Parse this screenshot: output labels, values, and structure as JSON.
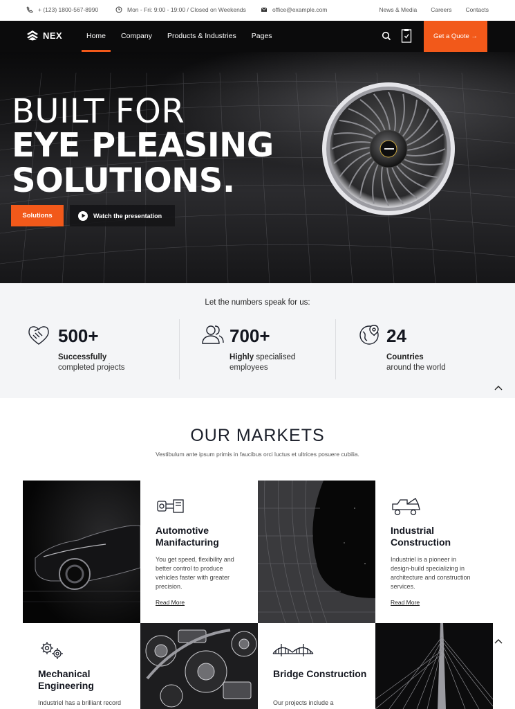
{
  "topbar": {
    "phone": "+ (123) 1800-567-8990",
    "hours": "Mon - Fri: 9:00 - 19:00 / Closed on Weekends",
    "email": "office@example.com",
    "links": [
      "News & Media",
      "Careers",
      "Contacts"
    ]
  },
  "nav": {
    "logo": "NEX",
    "items": [
      "Home",
      "Company",
      "Products & Industries",
      "Pages"
    ],
    "active": "Home",
    "quote_label": "Get a Quote →"
  },
  "hero": {
    "line1": "BUILT FOR",
    "line2": "EYE PLEASING",
    "line3": "SOLUTIONS.",
    "primary_button": "Solutions",
    "secondary_button": "Watch the presentation"
  },
  "stats": {
    "lead": "Let the numbers speak for us:",
    "items": [
      {
        "number": "500+",
        "strong": "Successfully",
        "rest": "",
        "line2": "completed projects",
        "icon": "handshake-icon"
      },
      {
        "number": "700+",
        "strong": "Highly",
        "rest": " specialised",
        "line2": "employees",
        "icon": "users-icon"
      },
      {
        "number": "24",
        "strong": "Countries",
        "rest": "",
        "line2": "around the world",
        "icon": "globe-icon"
      }
    ]
  },
  "markets": {
    "title": "OUR MARKETS",
    "subtitle": "Vestibulum ante ipsum primis in faucibus orci luctus et ultrices posuere cubilia.",
    "cards": [
      {
        "title": "Automotive Manifacturing",
        "text": "You get speed, flexibility and better control to produce vehicles faster with greater precision.",
        "more": "Read More",
        "icon": "piston-icon"
      },
      {
        "title": "Industrial Construction",
        "text": "Industriel is a pioneer in design-build specializing in architecture and construction services.",
        "more": "Read More",
        "icon": "truck-icon"
      },
      {
        "title": "Mechanical Engineering",
        "text": "Industriel has a brilliant record",
        "more": "",
        "icon": "gears-icon"
      },
      {
        "title": "Bridge Construction",
        "text": "Our projects include a",
        "more": "",
        "icon": "bridge-icon"
      }
    ]
  },
  "colors": {
    "accent": "#f2591a",
    "dark": "#0b0b0c",
    "stats_bg": "#f4f5f7"
  }
}
